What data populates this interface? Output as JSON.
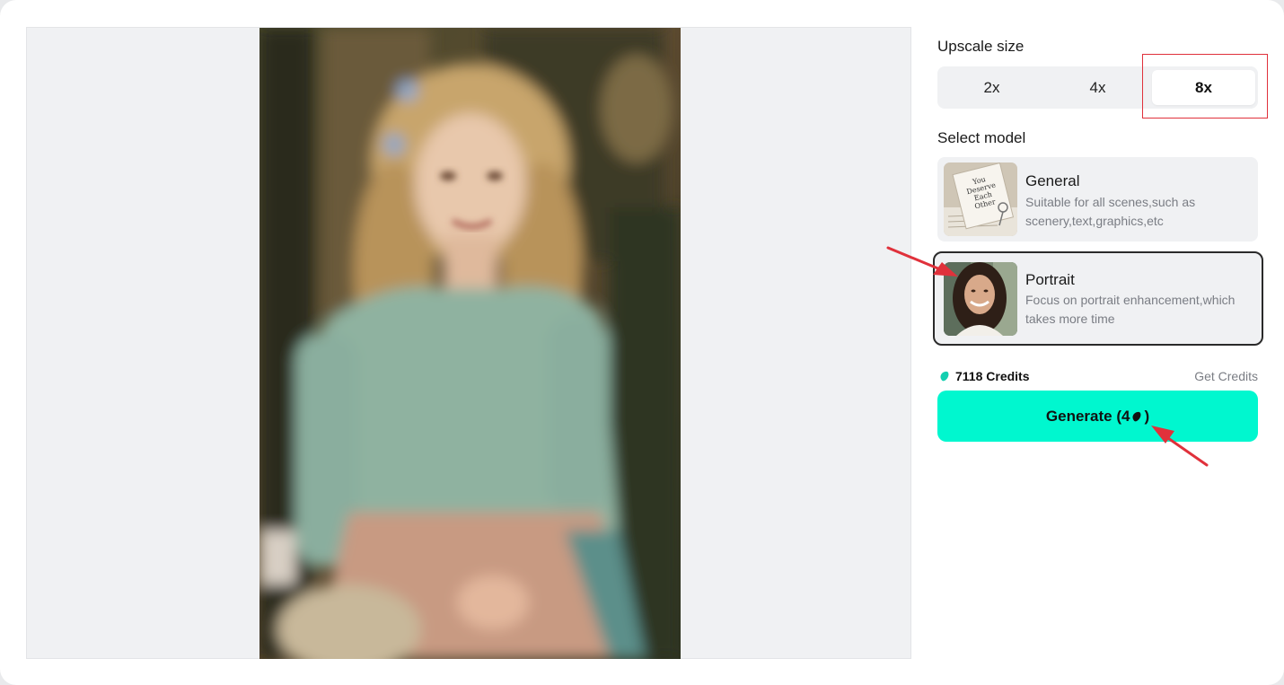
{
  "upscale": {
    "label": "Upscale size",
    "options": [
      "2x",
      "4x",
      "8x"
    ],
    "selected": "8x"
  },
  "model": {
    "label": "Select model",
    "options": [
      {
        "title": "General",
        "description": "Suitable for all scenes,such as scenery,text,graphics,etc",
        "thumb_text": "You Deserve Each Other"
      },
      {
        "title": "Portrait",
        "description": "Focus on portrait enhancement,which takes more time"
      }
    ],
    "selected": "Portrait"
  },
  "credits": {
    "amount": "7118 Credits",
    "get_label": "Get Credits"
  },
  "generate": {
    "label": "Generate (4",
    "suffix": ")"
  },
  "colors": {
    "accent": "#00f7cf",
    "highlight": "#e0313b",
    "panel_bg": "#f0f1f3"
  },
  "icons": [
    "credits-bean-icon",
    "annotation-arrow"
  ]
}
